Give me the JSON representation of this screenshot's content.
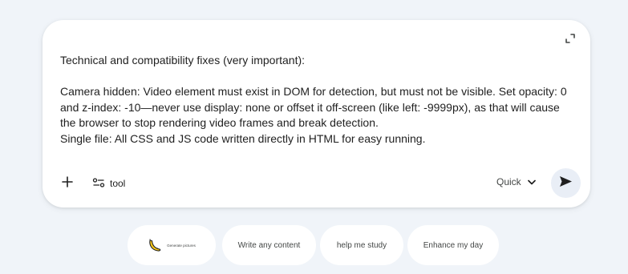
{
  "composer": {
    "prompt_text": "Technical and compatibility fixes (very important):\n\nCamera hidden: Video element must exist in DOM for detection, but must not be visible. Set opacity: 0 and z-index: -10—never use display: none or offset it off-screen (like left: -9999px), as that will cause the browser to stop rendering video frames and break detection.\nSingle file: All CSS and JS code written directly in HTML for easy running.",
    "expand_icon": "expand-icon",
    "add_icon": "plus-icon",
    "tool_icon": "sliders-icon",
    "tool_label": "tool",
    "mode_label": "Quick",
    "mode_icon": "chevron-down-icon",
    "send_icon": "send-icon"
  },
  "suggestions": [
    {
      "label": "Generate pictures",
      "icon": "banana-icon"
    },
    {
      "label": "Write any content"
    },
    {
      "label": "help me study"
    },
    {
      "label": "Enhance my day"
    }
  ],
  "colors": {
    "page_background": "#f0f4f9",
    "card_background": "#ffffff",
    "send_button_background": "#e9eef6",
    "banana_yellow": "#f5c518",
    "text": "#1f1f1f",
    "secondary_text": "#444746"
  }
}
